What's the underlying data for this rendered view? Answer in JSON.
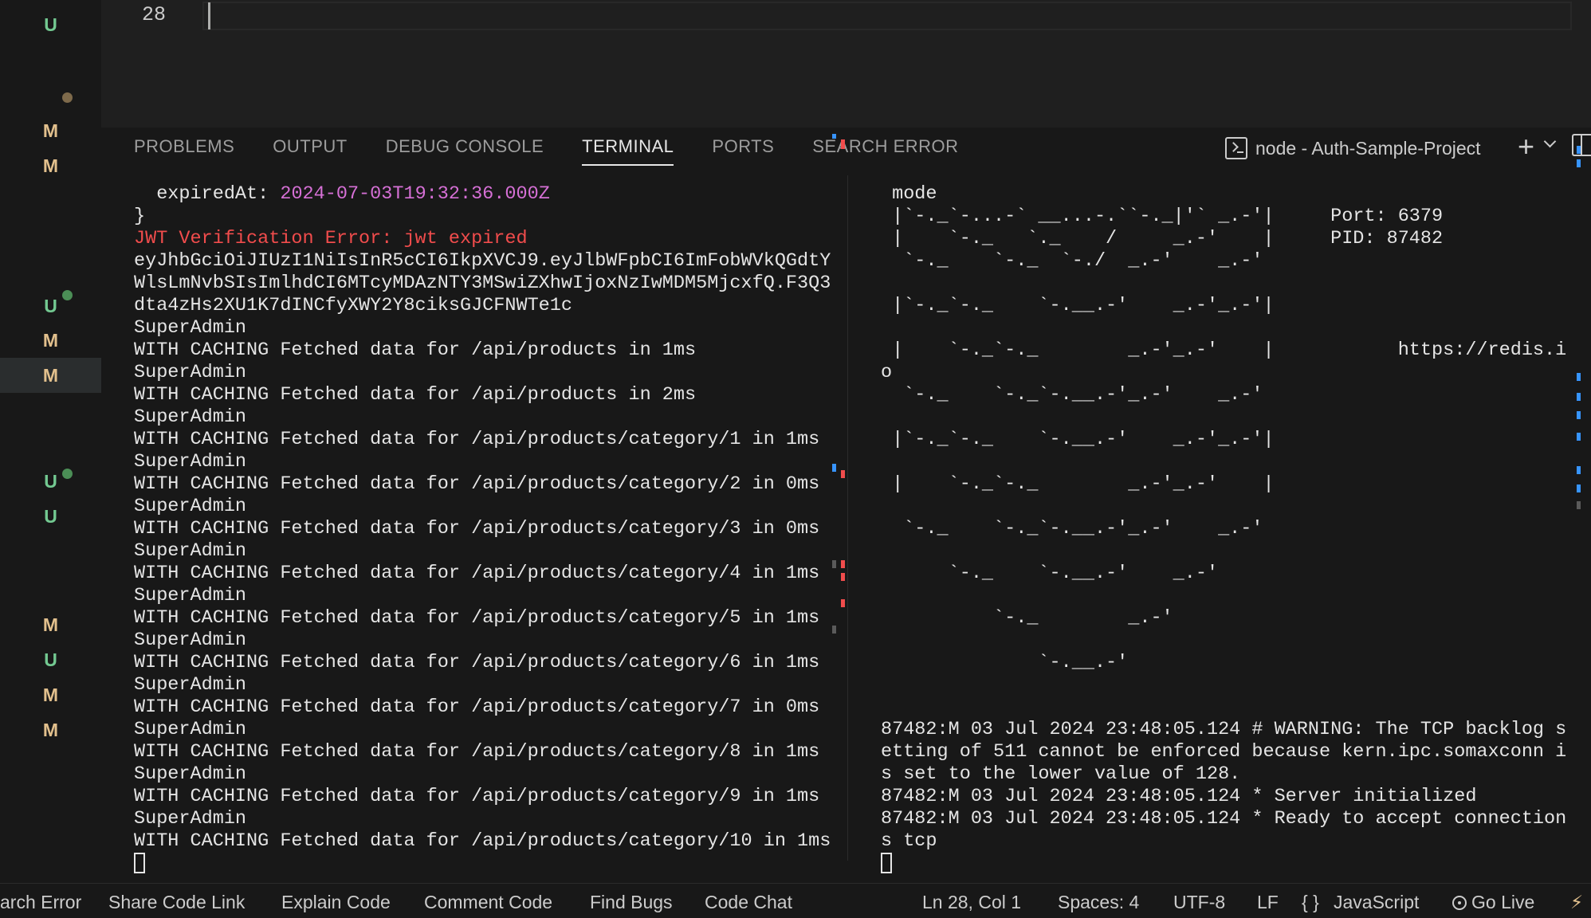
{
  "editor": {
    "line_number": "28"
  },
  "gutter": {
    "marks": [
      {
        "label": "U",
        "color": "#73c991"
      },
      {
        "label": "",
        "color": "#7e6a4b"
      },
      {
        "label": "M",
        "color": "#e2c08d"
      },
      {
        "label": "M",
        "color": "#e2c08d"
      },
      {
        "label": "",
        "color": "#4b8e56"
      },
      {
        "label": "U",
        "color": "#73c991"
      },
      {
        "label": "M",
        "color": "#e2c08d"
      },
      {
        "label": "M",
        "color": "#e2c08d"
      },
      {
        "label": "",
        "color": "#4b8e56"
      },
      {
        "label": "U",
        "color": "#73c991"
      },
      {
        "label": "U",
        "color": "#73c991"
      },
      {
        "label": "M",
        "color": "#e2c08d"
      },
      {
        "label": "U",
        "color": "#73c991"
      },
      {
        "label": "M",
        "color": "#e2c08d"
      },
      {
        "label": "M",
        "color": "#e2c08d"
      }
    ]
  },
  "panel": {
    "tabs": [
      "PROBLEMS",
      "OUTPUT",
      "DEBUG CONSOLE",
      "TERMINAL",
      "PORTS",
      "SEARCH ERROR"
    ],
    "active_tab": "TERMINAL",
    "terminal_name": "node - Auth-Sample-Project",
    "plus": "+"
  },
  "terminal_left": {
    "expired_key": "  expiredAt: ",
    "expired_value": "2024-07-03T19:32:36.000Z",
    "brace": "}",
    "error": "JWT Verification Error: jwt expired",
    "token_lines": [
      "eyJhbGciOiJIUzI1NiIsInR5cCI6IkpXVCJ9.eyJlbWFpbCI6ImFobWVkQGdtY",
      "WlsLmNvbSIsImlhdCI6MTcyMDAzNTY3MSwiZXhwIjoxNzIwMDM5MjcxfQ.F3Q3",
      "dta4zHs2XU1K7dINCfyXWY2Y8ciksGJCFNWTe1c"
    ],
    "log_lines": [
      "SuperAdmin",
      "WITH CACHING Fetched data for /api/products in 1ms",
      "SuperAdmin",
      "WITH CACHING Fetched data for /api/products in 2ms",
      "SuperAdmin",
      "WITH CACHING Fetched data for /api/products/category/1 in 1ms",
      "SuperAdmin",
      "WITH CACHING Fetched data for /api/products/category/2 in 0ms",
      "SuperAdmin",
      "WITH CACHING Fetched data for /api/products/category/3 in 0ms",
      "SuperAdmin",
      "WITH CACHING Fetched data for /api/products/category/4 in 1ms",
      "SuperAdmin",
      "WITH CACHING Fetched data for /api/products/category/5 in 1ms",
      "SuperAdmin",
      "WITH CACHING Fetched data for /api/products/category/6 in 1ms",
      "SuperAdmin",
      "WITH CACHING Fetched data for /api/products/category/7 in 0ms",
      "SuperAdmin",
      "WITH CACHING Fetched data for /api/products/category/8 in 1ms",
      "SuperAdmin",
      "WITH CACHING Fetched data for /api/products/category/9 in 1ms",
      "SuperAdmin",
      "WITH CACHING Fetched data for /api/products/category/10 in 1ms"
    ]
  },
  "terminal_right": {
    "lines": [
      " mode",
      " |`-._`-...-` __...-.``-._|'` _.-'|     Port: 6379",
      " |    `-._   `._    /     _.-'    |     PID: 87482",
      "  `-._    `-._  `-./  _.-'    _.-'",
      "",
      " |`-._`-._    `-.__.-'    _.-'_.-'|",
      "",
      " |    `-._`-._        _.-'_.-'    |           https://redis.i",
      "o",
      "  `-._    `-._`-.__.-'_.-'    _.-'",
      "",
      " |`-._`-._    `-.__.-'    _.-'_.-'|",
      "",
      " |    `-._`-._        _.-'_.-'    |",
      "",
      "  `-._    `-._`-.__.-'_.-'    _.-'",
      "",
      "      `-._    `-.__.-'    _.-'",
      "",
      "          `-._        _.-'",
      "",
      "              `-.__.-'",
      "",
      "",
      "87482:M 03 Jul 2024 23:48:05.124 # WARNING: The TCP backlog s",
      "etting of 511 cannot be enforced because kern.ipc.somaxconn i",
      "s set to the lower value of 128.",
      "87482:M 03 Jul 2024 23:48:05.124 * Server initialized",
      "87482:M 03 Jul 2024 23:48:05.124 * Ready to accept connection",
      "s tcp"
    ]
  },
  "statusbar": {
    "search_error": "arch Error",
    "share_code_link": "Share Code Link",
    "explain_code": "Explain Code",
    "comment_code": "Comment Code",
    "find_bugs": "Find Bugs",
    "code_chat": "Code Chat",
    "position": "Ln 28, Col 1",
    "spaces": "Spaces: 4",
    "encoding": "UTF-8",
    "eol": "LF",
    "language_icon": "{ }",
    "language": "JavaScript",
    "go_live": "Go Live",
    "bolt": "⚡"
  },
  "colors": {
    "added": "#73c991",
    "modified": "#e2c08d",
    "error": "#f14c4c",
    "date": "#d670d6"
  }
}
